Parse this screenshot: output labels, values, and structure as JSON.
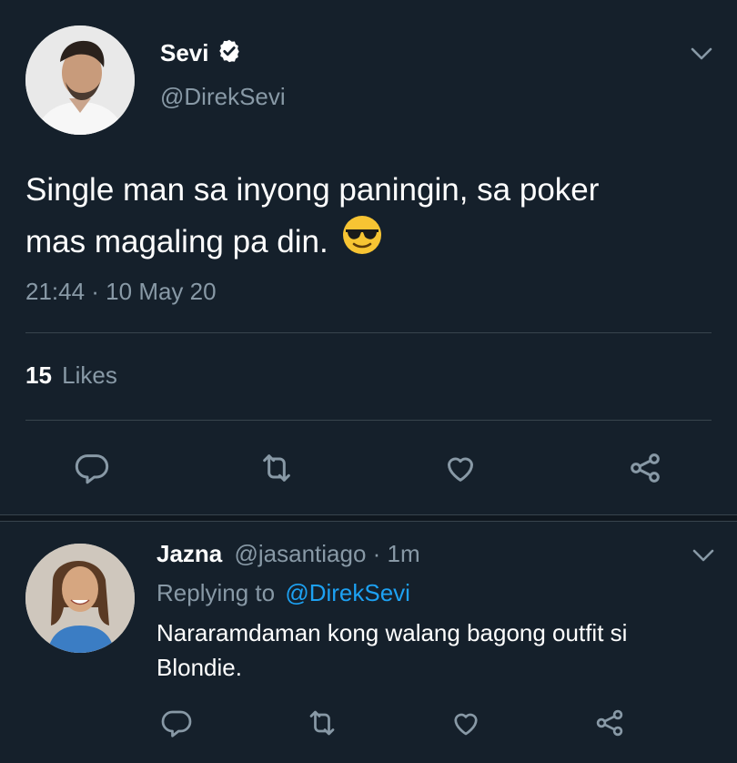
{
  "tweet": {
    "name": "Sevi",
    "handle": "@DirekSevi",
    "text_line1": "Single man sa inyong paningin, sa poker",
    "text_line2": "mas magaling pa din.",
    "emoji": "😎",
    "timestamp": "21:44 · 10 May 20",
    "likes_count": "15",
    "likes_label": "Likes"
  },
  "reply": {
    "name": "Jazna",
    "handle_time": "@jasantiago · 1m",
    "replying_label": "Replying to",
    "replying_to": "@DirekSevi",
    "text_line1": "Nararamdaman kong walang bagong outfit si",
    "text_line2": "Blondie."
  },
  "icons": [
    "verified-badge-icon",
    "chevron-down-icon",
    "reply-icon",
    "retweet-icon",
    "like-icon",
    "share-icon"
  ],
  "colors": {
    "background": "#15202b",
    "muted": "#8899a6",
    "link": "#1da1f2",
    "divider": "#38444d"
  }
}
